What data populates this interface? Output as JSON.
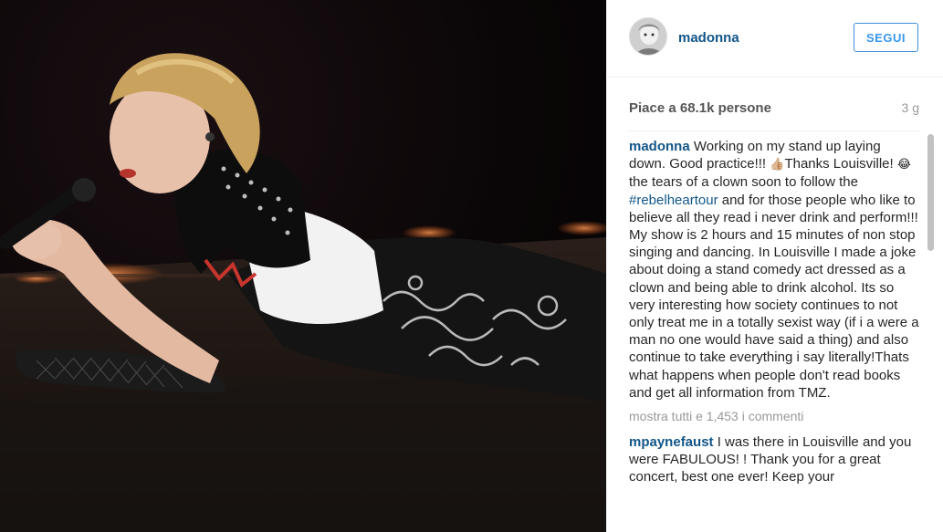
{
  "photo": {
    "alt_icon": "performer-photo"
  },
  "header": {
    "username": "madonna",
    "follow_label": "SEGUI"
  },
  "stats": {
    "likes": "Piace a 68.1k persone",
    "time": "3 g"
  },
  "caption": {
    "username": "madonna",
    "text_part1": " Working on my stand up laying down. Good practice!!! ",
    "emoji1": "👍🏼",
    "text_part2": "Thanks Louisville! ",
    "emoji2": "😂",
    "text_part3": "the tears of a clown soon to follow the ",
    "hashtag": "#rebelheartour",
    "text_part4": " and for those people who like to believe all they read i never drink and perform!!! My show is 2 hours and 15 minutes of non stop singing and dancing. In Louisville I made a joke about doing a stand comedy act dressed as a clown and being able to drink alcohol. Its so very interesting how society continues to not only treat me in a totally sexist way (if i a were a man no one would have said a thing) and also continue to take everything i say literally!Thats what happens when people don't read books and get all information from TMZ."
  },
  "more_comments": "mostra tutti e 1,453 i commenti",
  "comments": [
    {
      "username": "mpaynefaust",
      "text": " I was there in Louisville and you were FABULOUS! ! Thank you for a great concert, best one ever! Keep your"
    }
  ]
}
